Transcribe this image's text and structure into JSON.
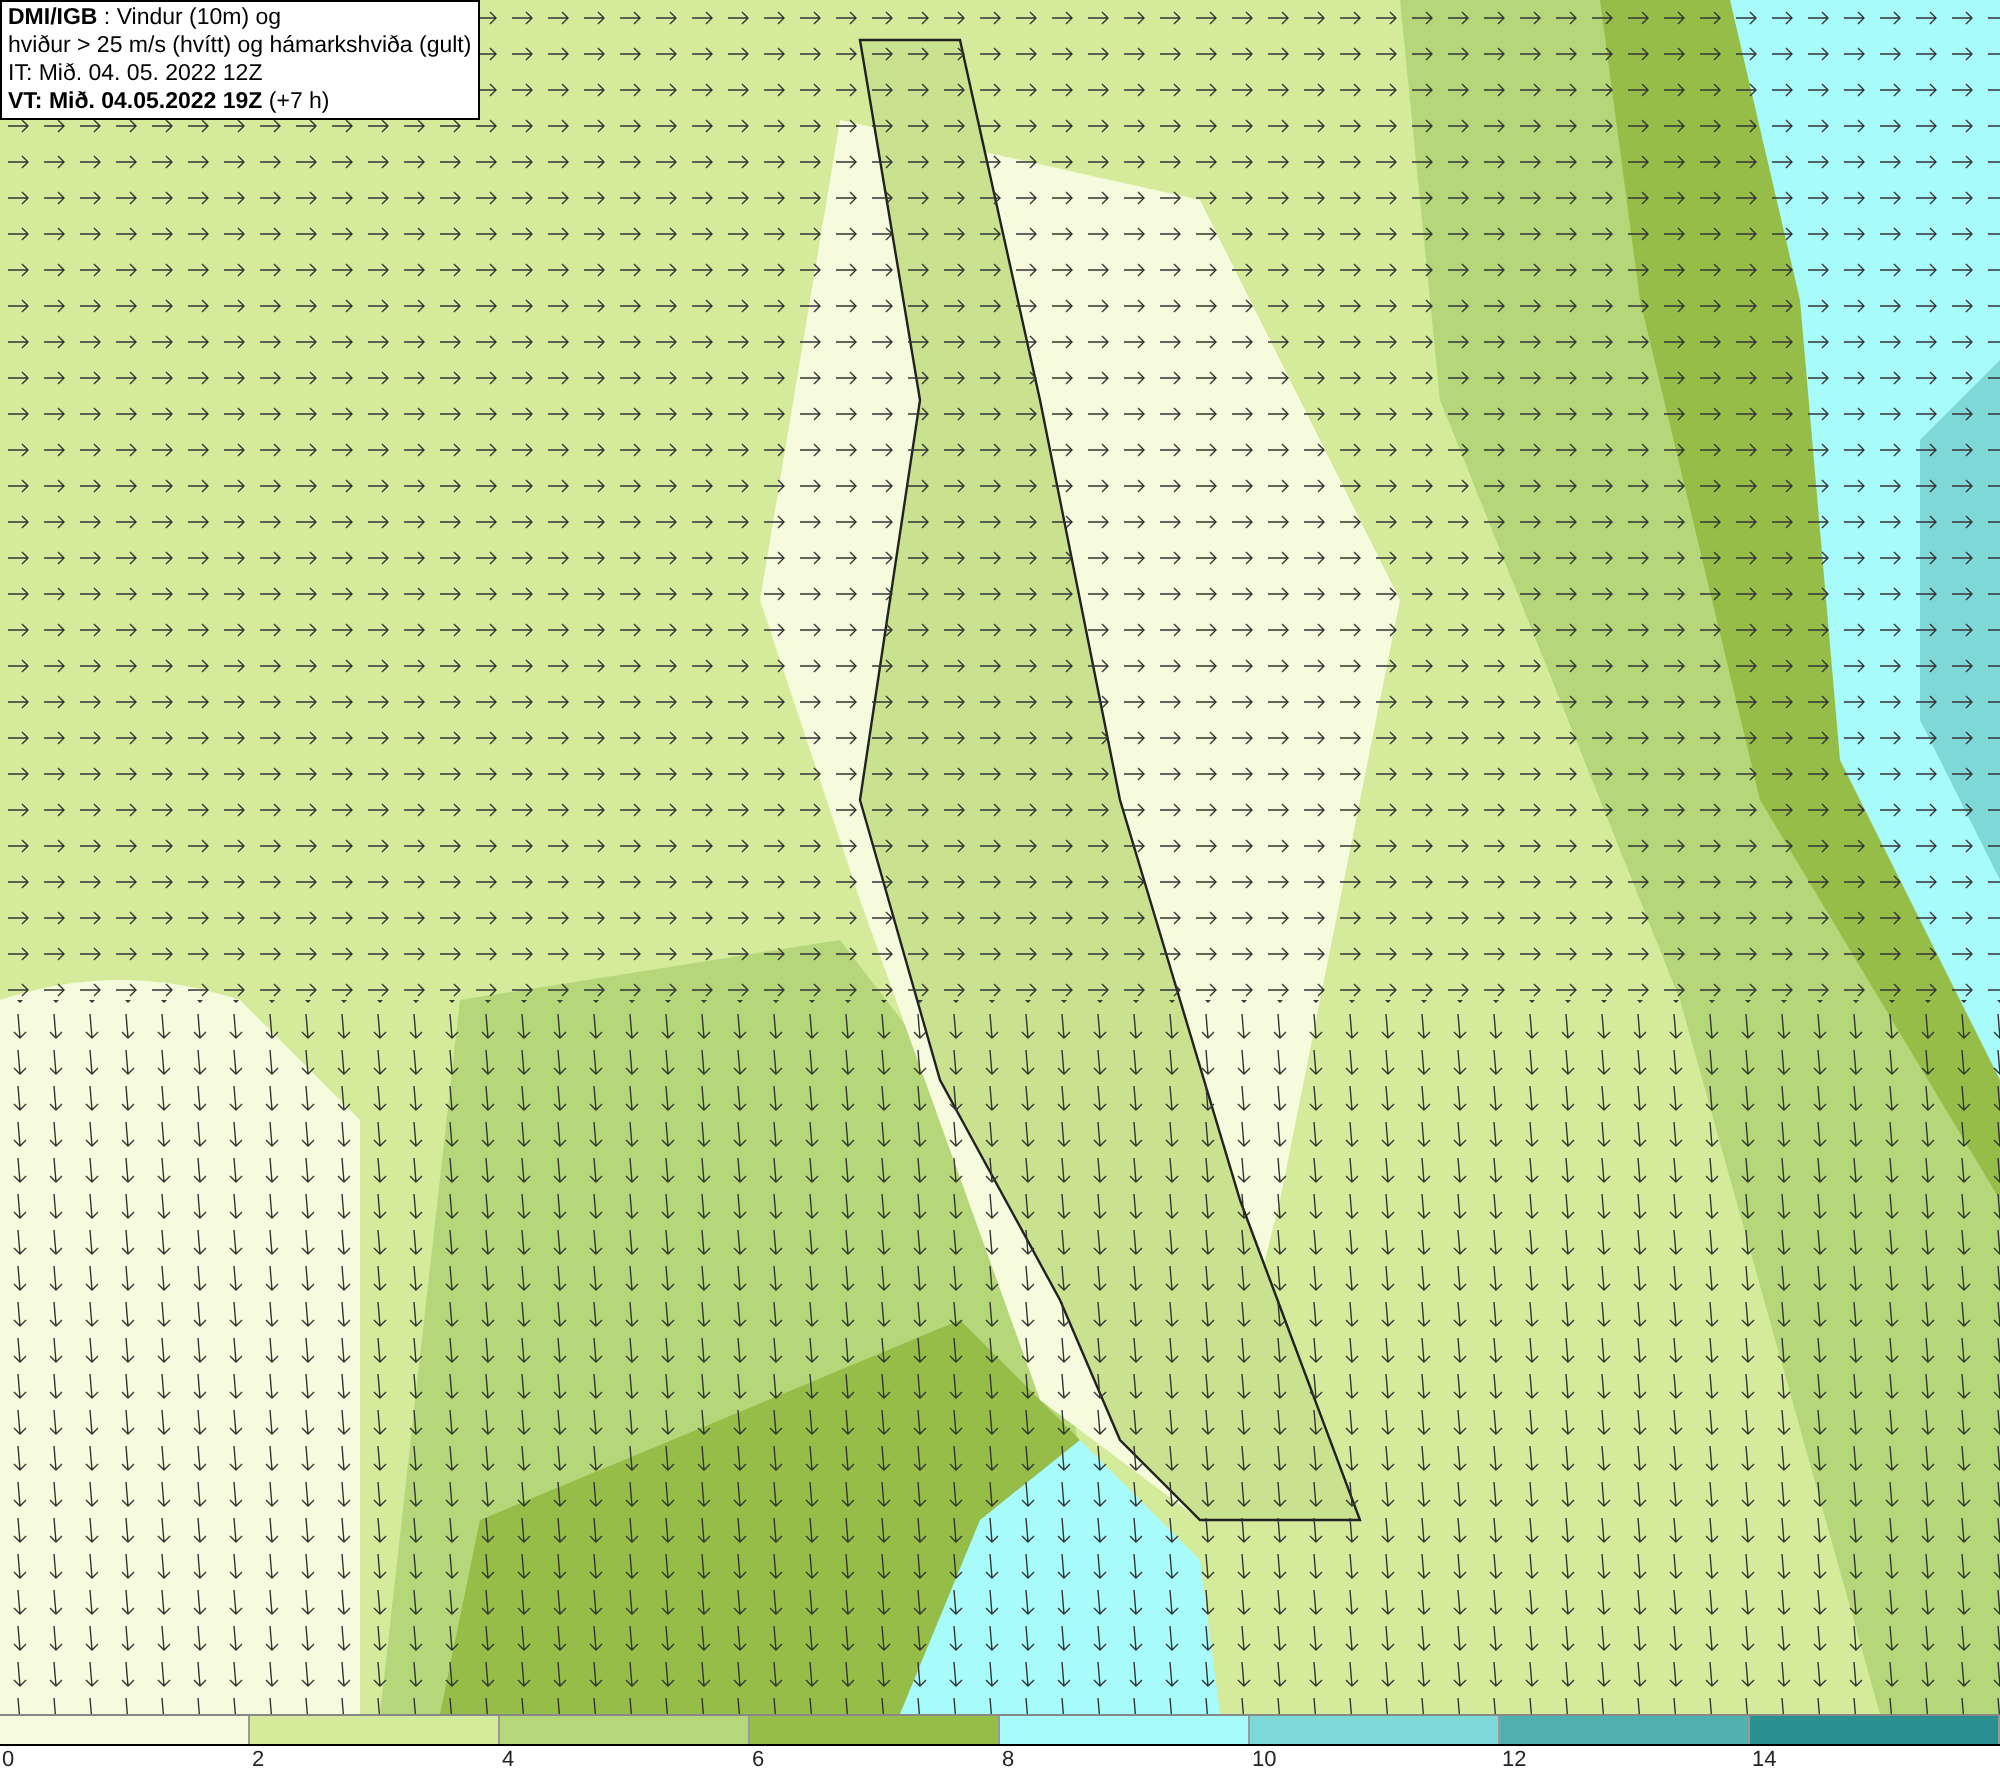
{
  "header": {
    "lines": [
      "**DMI/IGB** : Vindur (10m) og",
      "hviður > 25 m/s (hvítt) og hámarkshviða (gult)",
      "IT: Mið. 04. 05. 2022 12Z",
      "**VT: Mið. 04.05.2022 19Z** (+7 h)"
    ]
  },
  "legend": {
    "bins": [
      {
        "color": "#f5fbdc"
      },
      {
        "color": "#d4eb9c"
      },
      {
        "color": "#b5d77a"
      },
      {
        "color": "#96bd48"
      },
      {
        "color": "#a8fbfb"
      },
      {
        "color": "#7fd8d8"
      },
      {
        "color": "#50b0b0"
      },
      {
        "color": "#2a9090"
      }
    ],
    "ticks": [
      "0",
      "2",
      "4",
      "6",
      "8",
      "10",
      "12",
      "14"
    ]
  }
}
